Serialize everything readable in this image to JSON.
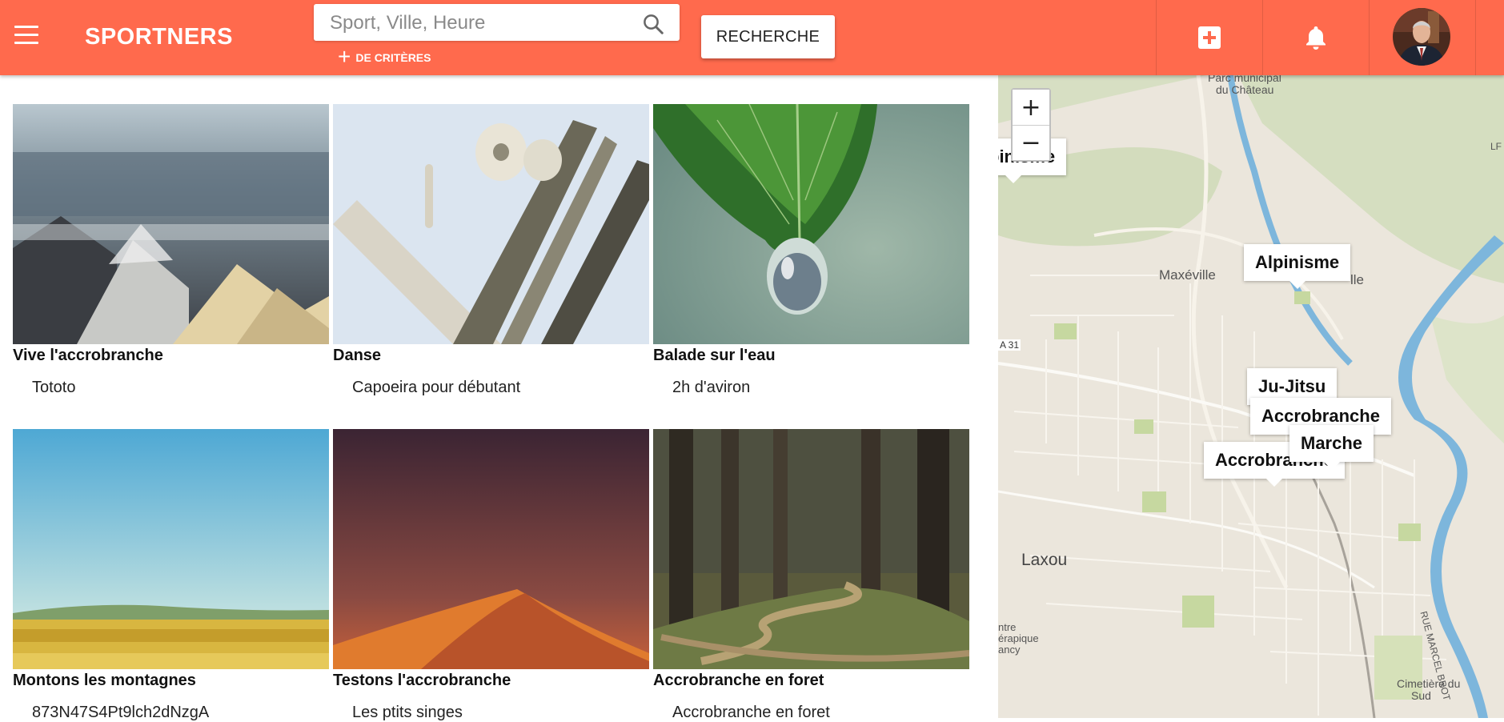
{
  "header": {
    "brand": "SPORTNERS",
    "search_placeholder": "Sport, Ville, Heure",
    "criteria_label": "DE CRITÈRES",
    "search_button": "RECHERCHE",
    "accent_color": "#ff6a4d"
  },
  "icons": {
    "menu": "menu-icon",
    "search": "search-icon",
    "add": "add-box-icon",
    "notifications": "bell-icon",
    "avatar": "user-avatar"
  },
  "activities": [
    {
      "title": "Vive l'accrobranche",
      "subtitle": "Tototo"
    },
    {
      "title": "Danse",
      "subtitle": "Capoeira pour débutant"
    },
    {
      "title": "Balade sur l'eau",
      "subtitle": "2h d'aviron"
    },
    {
      "title": "Montons les montagnes",
      "subtitle": "873N47S4Pt9lch2dNzgA"
    },
    {
      "title": "Testons l'accrobranche",
      "subtitle": "Les ptits singes"
    },
    {
      "title": "Accrobranche en foret",
      "subtitle": "Accrobranche en foret"
    }
  ],
  "map": {
    "zoom_in": "+",
    "zoom_out": "−",
    "markers": [
      "Alpinisme",
      "Alpinisme",
      "Ju-Jitsu",
      "Accrobranche",
      "Accrobranche",
      "Marche"
    ],
    "places": [
      "Parc municipal",
      "du Château",
      "Maxéville",
      "lle",
      "Laxou",
      "Cimetière du",
      "Sud",
      "RUE MARCEL BROT",
      "A 31",
      "LF",
      "ntre",
      "érapique",
      "ancy"
    ]
  }
}
